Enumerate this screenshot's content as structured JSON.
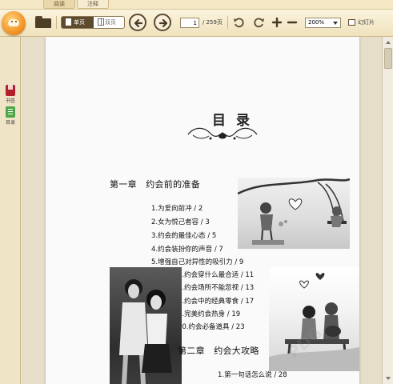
{
  "mode_tabs": {
    "read": "阅读",
    "note": "注释"
  },
  "toolbar": {
    "single_page": "单页",
    "double_page": "双页",
    "current_page": "1",
    "page_total": "/ 259页",
    "zoom": "200%",
    "slideshow": "幻灯片"
  },
  "sidebar": {
    "bookmark": "书签",
    "toc": "目录"
  },
  "page": {
    "title": "目录",
    "chapter1": "第一章　约会前的准备",
    "entries1": [
      "1.为爱向前冲 / 2",
      "2.女为悦己者容 / 3",
      "3.约会的最佳心态 / 5",
      "4.约会装扮你的声音 / 7",
      "5.增强自己对异性的吸引力 / 9",
      "6.约会穿什么最合适 / 11",
      "7.约会场所不能忽视 / 13",
      "8.约会中的经典零食 / 17",
      "9.完美约会热身 / 19",
      "10.约会必备道具 / 23"
    ],
    "chapter2": "第二章　约会大攻略",
    "entries2": [
      "1.第一句话怎么说 / 28"
    ]
  },
  "colors": {
    "chrome_bg": "#efe2bd",
    "logo_orange": "#f08c1c",
    "active_mode": "#5e4a2c",
    "bookmark_red": "#b3202a",
    "toc_green": "#4fa54a"
  }
}
